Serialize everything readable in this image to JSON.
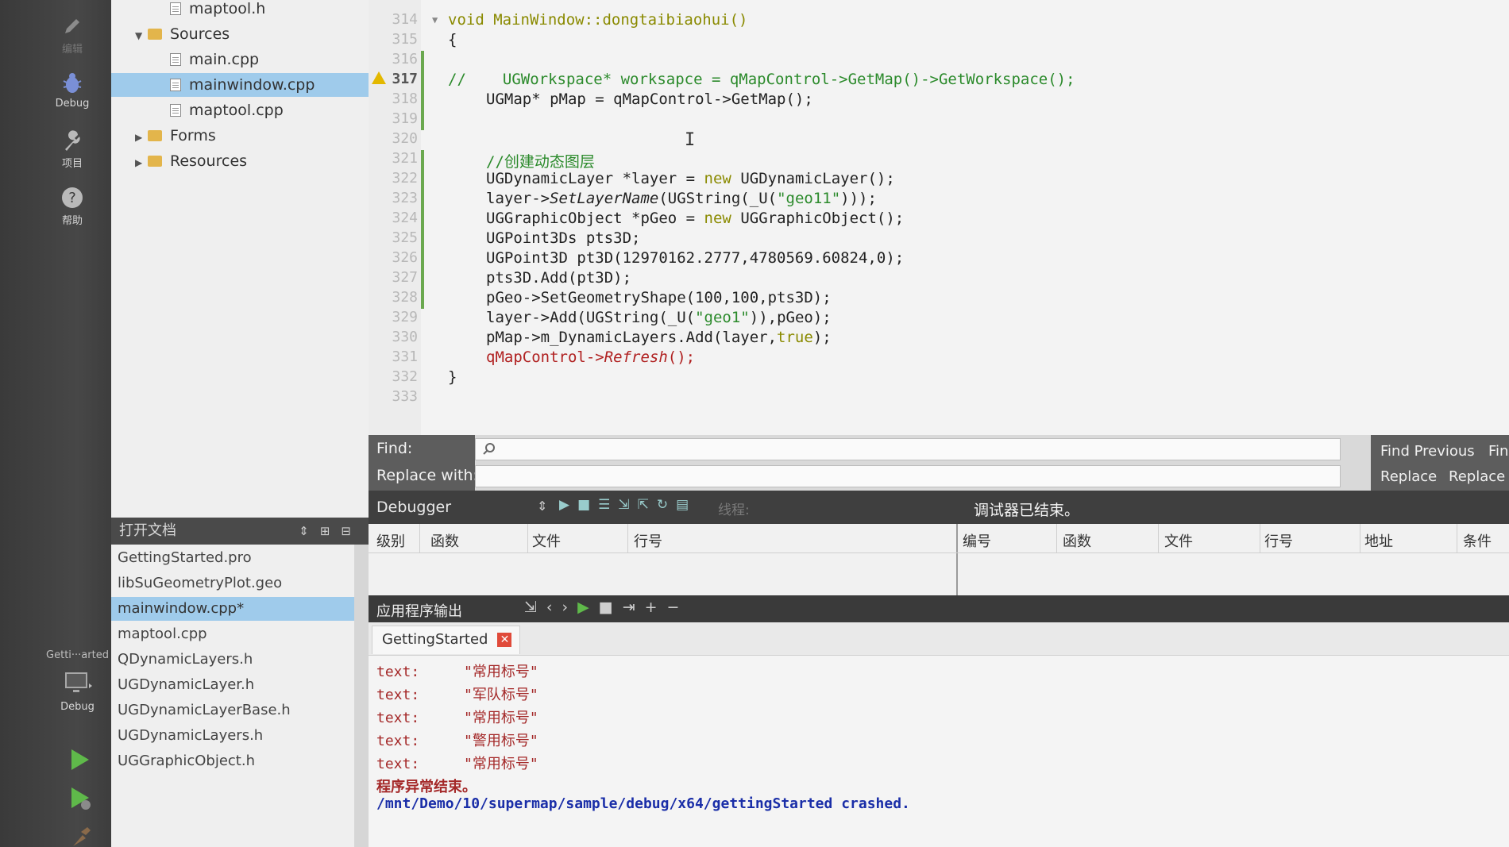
{
  "modebar": {
    "items": [
      {
        "label": "编辑",
        "icon": "edit-icon"
      },
      {
        "label": "Debug",
        "icon": "debug-icon"
      },
      {
        "label": "项目",
        "icon": "wrench-icon"
      },
      {
        "label": "帮助",
        "icon": "help-icon"
      }
    ],
    "target_name": "Getti···arted",
    "target_mode": "Debug"
  },
  "tree": {
    "items": [
      {
        "label": "maptool.h",
        "kind": "file"
      },
      {
        "label": "Sources",
        "kind": "folder",
        "expanded": true
      },
      {
        "label": "main.cpp",
        "kind": "file"
      },
      {
        "label": "mainwindow.cpp",
        "kind": "file",
        "selected": true
      },
      {
        "label": "maptool.cpp",
        "kind": "file"
      },
      {
        "label": "Forms",
        "kind": "folder",
        "expanded": false
      },
      {
        "label": "Resources",
        "kind": "folder",
        "expanded": false
      }
    ]
  },
  "opendocs": {
    "title": "打开文档",
    "items": [
      "GettingStarted.pro",
      "libSuGeometryPlot.geo",
      "mainwindow.cpp*",
      "maptool.cpp",
      "QDynamicLayers.h",
      "UGDynamicLayer.h",
      "UGDynamicLayerBase.h",
      "UGDynamicLayers.h",
      "UGGraphicObject.h"
    ],
    "selected_index": 2
  },
  "editor": {
    "current_line": "317",
    "line_numbers": [
      "314",
      "315",
      "316",
      "317",
      "318",
      "319",
      "320",
      "321",
      "322",
      "323",
      "324",
      "325",
      "326",
      "327",
      "328",
      "329",
      "330",
      "331",
      "332",
      "333"
    ],
    "lines": {
      "l314": "void MainWindow::dongtaibiaohui()",
      "l315": "{",
      "l317a": "//",
      "l317b": "UGWorkspace* worksapce = qMapControl->GetMap()->GetWorkspace();",
      "l318": "UGMap* pMap = qMapControl->GetMap();",
      "l321": "//创建动态图层",
      "l322a": "UGDynamicLayer *layer = ",
      "l322b": "new",
      "l322c": " UGDynamicLayer();",
      "l323a": "layer->",
      "l323b": "SetLayerName",
      "l323c": "(UGString(_U(",
      "l323d": "\"geo11\"",
      "l323e": ")));",
      "l324a": "UGGraphicObject *pGeo = ",
      "l324b": "new",
      "l324c": " UGGraphicObject();",
      "l325": "UGPoint3Ds pts3D;",
      "l326": "UGPoint3D pt3D(12970162.2777,4780569.60824,0);",
      "l327": "pts3D.Add(pt3D);",
      "l328": "pGeo->SetGeometryShape(100,100,pts3D);",
      "l329a": "layer->Add(UGString(_U(",
      "l329b": "\"geo1\"",
      "l329c": ")),pGeo);",
      "l330a": "pMap->m_DynamicLayers.Add(layer,",
      "l330b": "true",
      "l330c": ");",
      "l331a": "qMapControl->",
      "l331b": "Refresh",
      "l331c": "();",
      "l332": "}"
    }
  },
  "find": {
    "find_label": "Find:",
    "replace_label": "Replace with:",
    "find_value": "",
    "replace_value": "",
    "find_previous": "Find Previous",
    "find_next": "Fin",
    "replace": "Replace",
    "replace_all": "Replace"
  },
  "debugger": {
    "title": "Debugger",
    "thread_label": "线程:",
    "status": "调试器已结束。",
    "stack_columns": [
      "级别",
      "函数",
      "文件",
      "行号"
    ],
    "breakpoint_columns": [
      "编号",
      "函数",
      "文件",
      "行号",
      "地址",
      "条件"
    ]
  },
  "output": {
    "title": "应用程序输出",
    "tab": "GettingStarted",
    "lines": [
      {
        "key": "text:",
        "value": "\"常用标号\""
      },
      {
        "key": "text:",
        "value": "\"军队标号\""
      },
      {
        "key": "text:",
        "value": "\"常用标号\""
      },
      {
        "key": "text:",
        "value": "\"警用标号\""
      },
      {
        "key": "text:",
        "value": "\"常用标号\""
      }
    ],
    "error": "程序异常结束。",
    "crash": "/mnt/Demo/10/supermap/sample/debug/x64/gettingStarted crashed."
  },
  "colors": {
    "selection": "#9fcbeb",
    "comment": "#2b8a2b",
    "keyword": "#8a8a00",
    "output_text": "#a42828",
    "crash_text": "#1a2ea8"
  }
}
